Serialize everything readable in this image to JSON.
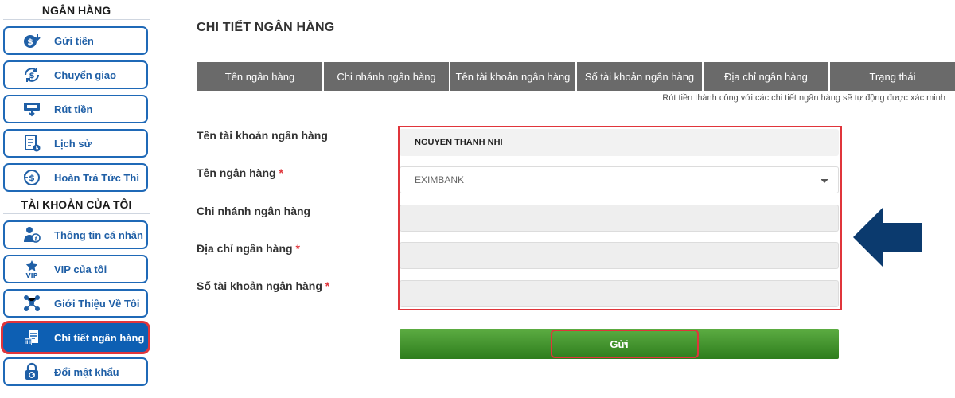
{
  "sidebar": {
    "section_bank": "NGÂN HÀNG",
    "section_account": "TÀI KHOẢN CỦA TÔI",
    "items": [
      {
        "label": "Gửi tiền",
        "icon": "money-bag-icon"
      },
      {
        "label": "Chuyển giao",
        "icon": "transfer-icon"
      },
      {
        "label": "Rút tiền",
        "icon": "withdraw-icon"
      },
      {
        "label": "Lịch sử",
        "icon": "history-icon"
      },
      {
        "label": "Hoàn Trả Tức Thì",
        "icon": "instant-refund-icon"
      },
      {
        "label": "Thông tin cá nhân",
        "icon": "personal-info-icon"
      },
      {
        "label": "VIP của tôi",
        "icon": "vip-star-icon"
      },
      {
        "label": "Giới Thiệu Về Tôi",
        "icon": "referral-network-icon"
      },
      {
        "label": "Chi tiết ngân hàng",
        "icon": "bank-details-icon",
        "active": true
      },
      {
        "label": "Đổi mật khẩu",
        "icon": "lock-refresh-icon"
      }
    ]
  },
  "main": {
    "title": "CHI TIẾT NGÂN HÀNG",
    "table": {
      "headers": [
        "Tên ngân hàng",
        "Chi nhánh ngân hàng",
        "Tên tài khoản ngân hàng",
        "Số tài khoản ngân hàng",
        "Địa chỉ ngân hàng",
        "Trạng thái"
      ],
      "note": "Rút tiền thành công với các chi tiết ngân hàng sẽ tự động được xác minh"
    },
    "form": {
      "account_name_label": "Tên tài khoản ngân hàng",
      "account_name_value": "NGUYEN THANH NHI",
      "bank_name_label": "Tên ngân hàng",
      "bank_name_value": "EXIMBANK",
      "branch_label": "Chi nhánh ngân hàng",
      "branch_value": "",
      "address_label": "Địa chỉ ngân hàng",
      "address_value": "",
      "account_number_label": "Số tài khoản ngân hàng",
      "account_number_value": "",
      "required_mark": "*",
      "submit_label": "Gửi"
    }
  },
  "colors": {
    "primary_blue": "#1f69b7",
    "highlight_red": "#e0353b",
    "submit_green": "#3f9230",
    "arrow_navy": "#0b3a6e",
    "table_header_gray": "#6a6a6a"
  }
}
